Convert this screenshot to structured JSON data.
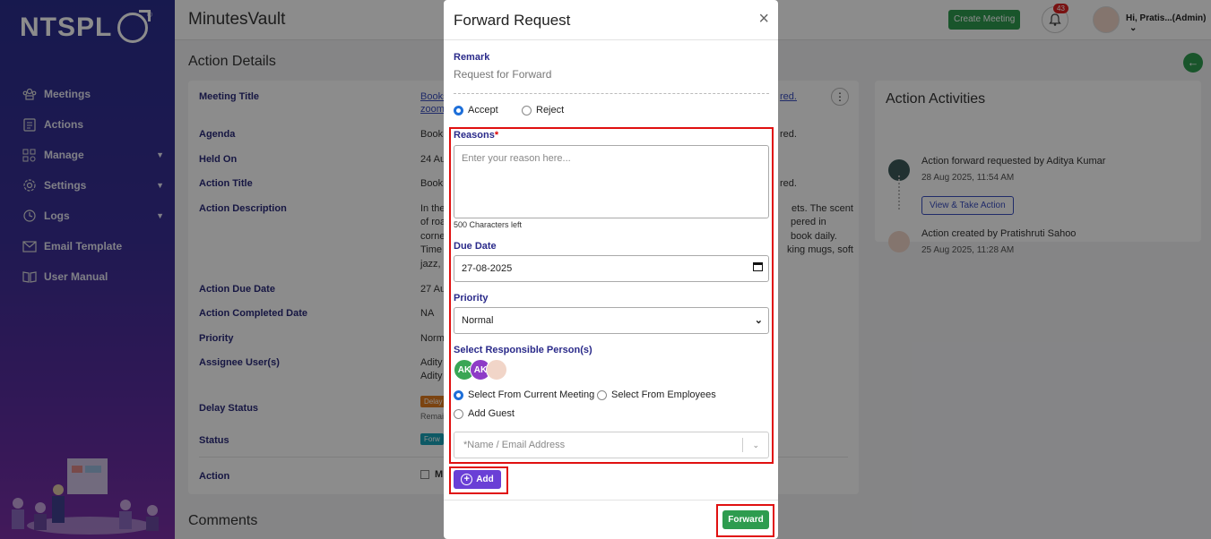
{
  "brand": {
    "logo_text": "NTSPL",
    "reg": "®"
  },
  "sidebar": {
    "items": [
      {
        "label": "Meetings",
        "icon": "meetings-icon",
        "caret": false
      },
      {
        "label": "Actions",
        "icon": "actions-icon",
        "caret": false
      },
      {
        "label": "Manage",
        "icon": "manage-icon",
        "caret": true
      },
      {
        "label": "Settings",
        "icon": "gear-icon",
        "caret": true
      },
      {
        "label": "Logs",
        "icon": "clock-icon",
        "caret": true
      },
      {
        "label": "Email Template",
        "icon": "envelope-icon",
        "caret": false
      },
      {
        "label": "User Manual",
        "icon": "book-icon",
        "caret": false
      }
    ]
  },
  "header": {
    "app_title": "MinutesVault",
    "create_meeting": "Create Meeting",
    "notification_count": "43",
    "user_name": "Hi, Pratis...(Admin)"
  },
  "details": {
    "section_title": "Action Details",
    "rows": [
      {
        "label": "Meeting Title",
        "value": "Books",
        "value2": "zoom",
        "right": "red."
      },
      {
        "label": "Agenda",
        "value": "Book",
        "right": "red."
      },
      {
        "label": "Held On",
        "value": "24 Au"
      },
      {
        "label": "Action Title",
        "value": "Book",
        "right": "red."
      },
      {
        "label": "Action Description",
        "value": "In the",
        "value2": "of roa",
        "value3": "corne",
        "value4": "Time",
        "value5": "jazz, a",
        "right": "ets. The scent",
        "right2": "pered in",
        "right3": "book daily.",
        "right4": "king mugs, soft"
      },
      {
        "label": "Action Due Date",
        "value": "27 Au"
      },
      {
        "label": "Action Completed Date",
        "value": "NA"
      },
      {
        "label": "Priority",
        "value": "Norm"
      },
      {
        "label": "Assignee User(s)",
        "value": "Adity",
        "value2": "Adity"
      },
      {
        "label": "Delay Status",
        "value": "Delay",
        "value2": "Remai"
      },
      {
        "label": "Status",
        "value": "Forw"
      },
      {
        "label": "Action",
        "value": "M"
      }
    ],
    "comments_title": "Comments"
  },
  "activities": {
    "title": "Action Activities",
    "items": [
      {
        "text": "Action forward requested by Aditya Kumar",
        "time": "28 Aug 2025, 11:54 AM",
        "button": "View & Take Action"
      },
      {
        "text": "Action created by Pratishruti Sahoo",
        "time": "25 Aug 2025, 11:28 AM"
      }
    ]
  },
  "modal": {
    "title": "Forward Request",
    "close": "×",
    "remark_label": "Remark",
    "remark_value": "Request for Forward",
    "accept": "Accept",
    "reject": "Reject",
    "decision_selected": "accept",
    "reasons_label": "Reasons",
    "reasons_required": "*",
    "reasons_placeholder": "Enter your reason here...",
    "chars_left": "500 Characters left",
    "due_date_label": "Due Date",
    "due_date_value": "27-08-2025",
    "priority_label": "Priority",
    "priority_value": "Normal",
    "responsible_label": "Select Responsible Person(s)",
    "avatars": [
      {
        "initials": "AK",
        "color": "#3aa655"
      },
      {
        "initials": "AK",
        "color": "#8e3bc7"
      },
      {
        "initials": "",
        "color": "#f1d5c8"
      }
    ],
    "from_meeting": "Select From Current Meeting",
    "from_employees": "Select From Employees",
    "add_guest": "Add Guest",
    "source_selected": "meeting",
    "guest_placeholder": "*Name / Email Address",
    "add_button": "Add",
    "forward_button": "Forward"
  },
  "colors": {
    "accent": "#2e9c4f",
    "brand_purple": "#6a3fd6",
    "highlight": "#e01010",
    "label_navy": "#2a2a8a"
  }
}
